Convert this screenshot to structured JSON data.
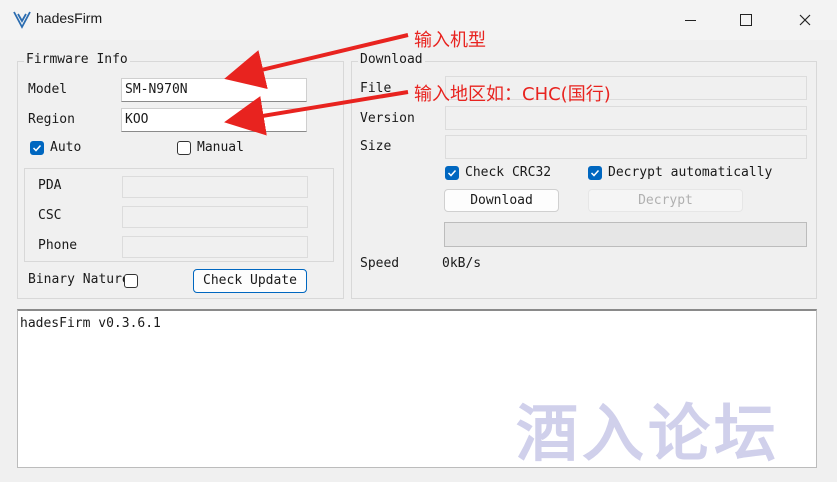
{
  "window": {
    "title": "hadesFirm",
    "minimize_icon": "minimize-icon",
    "maximize_icon": "maximize-icon",
    "close_icon": "close-icon"
  },
  "firmware_info": {
    "legend": "Firmware Info",
    "model_label": "Model",
    "model_value": "SM-N970N",
    "region_label": "Region",
    "region_value": "KOO",
    "auto_label": "Auto",
    "auto_checked": true,
    "manual_label": "Manual",
    "manual_checked": false,
    "pda_label": "PDA",
    "csc_label": "CSC",
    "phone_label": "Phone",
    "binary_nature_label": "Binary Nature",
    "binary_nature_checked": false,
    "check_update_label": "Check Update"
  },
  "download": {
    "legend": "Download",
    "file_label": "File",
    "version_label": "Version",
    "size_label": "Size",
    "check_crc_label": "Check CRC32",
    "check_crc_checked": true,
    "decrypt_auto_label": "Decrypt automatically",
    "decrypt_auto_checked": true,
    "download_button": "Download",
    "decrypt_button": "Decrypt",
    "speed_label": "Speed",
    "speed_value": "0kB/s",
    "progress": 0
  },
  "log": {
    "text": "hadesFirm v0.3.6.1"
  },
  "annotations": {
    "model_note": "输入机型",
    "region_note": "输入地区如：CHC(国行)",
    "color": "#e8231f"
  },
  "watermark": {
    "text": "酒入论坛"
  }
}
